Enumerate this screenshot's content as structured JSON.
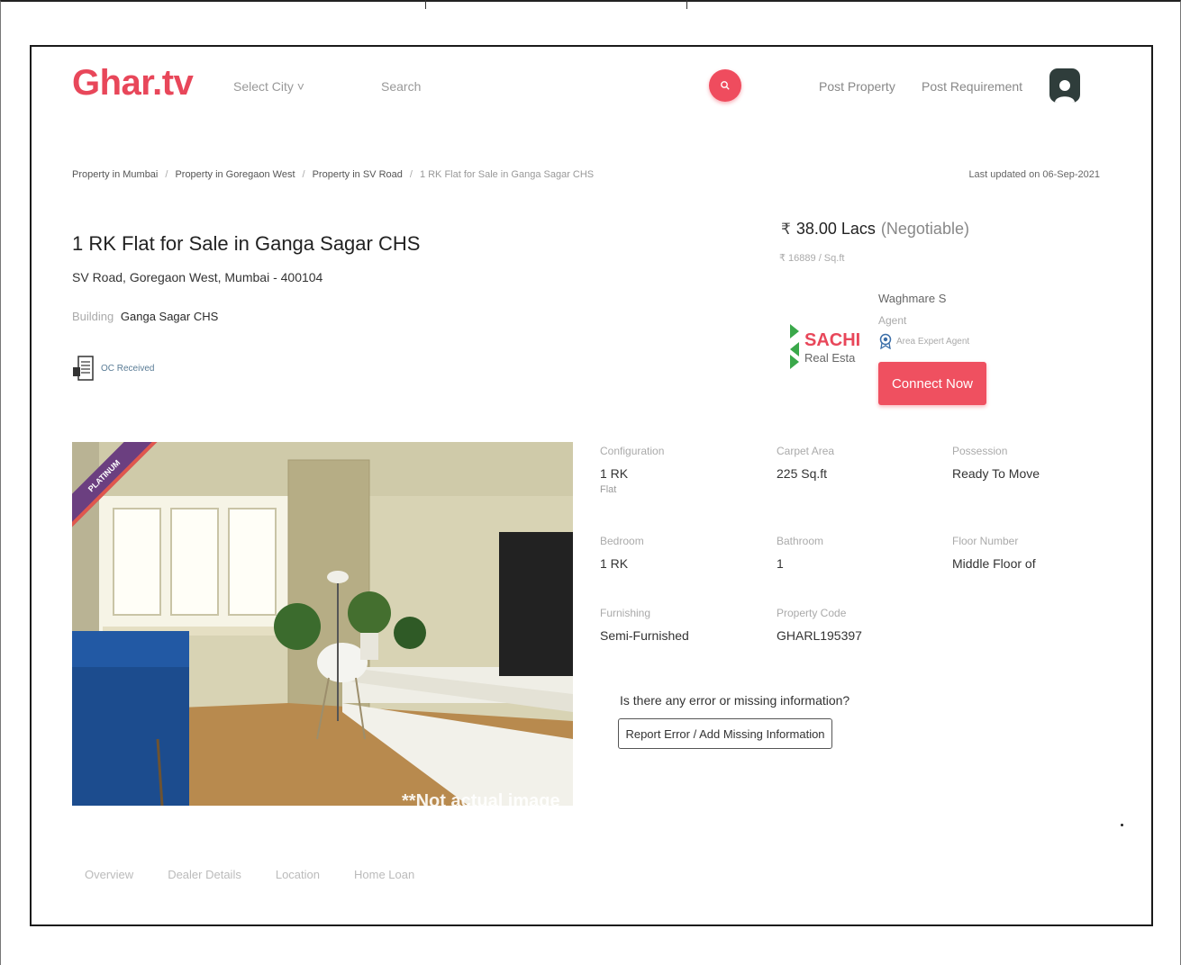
{
  "header": {
    "logo": "Ghar.tv",
    "city_select": "Select City ˅",
    "search_placeholder": "Search",
    "post_property": "Post Property",
    "post_requirement": "Post Requirement"
  },
  "breadcrumb": {
    "items": [
      "Property in Mumbai",
      "Property in Goregaon West",
      "Property in SV Road",
      "1 RK Flat for Sale in Ganga Sagar CHS"
    ],
    "separator": "/"
  },
  "last_updated": "Last updated on 06-Sep-2021",
  "listing": {
    "title": "1 RK Flat for Sale in Ganga Sagar CHS",
    "address": "SV Road, Goregaon West, Mumbai - 400104",
    "building_label": "Building",
    "building_value": "Ganga Sagar CHS",
    "oc_label": "OC Received",
    "price_symbol": "₹",
    "price": "38.00 Lacs",
    "negotiable": "(Negotiable)",
    "price_per_sqft": "₹ 16889 / Sq.ft",
    "photo_badge": "PLATINUM",
    "photo_caption": "**Not actual image"
  },
  "agent": {
    "logo_main": "SACHI",
    "logo_sub": "Real Esta",
    "name": "Waghmare S",
    "role": "Agent",
    "badge": "Area Expert Agent",
    "connect_button": "Connect Now"
  },
  "specs": [
    {
      "label": "Configuration",
      "value": "1 RK",
      "sub": "Flat"
    },
    {
      "label": "Carpet Area",
      "value": "225 Sq.ft",
      "sub": ""
    },
    {
      "label": "Possession",
      "value": "Ready To Move",
      "sub": ""
    },
    {
      "label": "Bedroom",
      "value": "1 RK",
      "sub": ""
    },
    {
      "label": "Bathroom",
      "value": "1",
      "sub": ""
    },
    {
      "label": "Floor Number",
      "value": "Middle Floor of",
      "sub": ""
    },
    {
      "label": "Furnishing",
      "value": "Semi-Furnished",
      "sub": ""
    },
    {
      "label": "Property Code",
      "value": "GHARL195397",
      "sub": ""
    }
  ],
  "error_report": {
    "question": "Is there any error or missing information?",
    "button": "Report Error / Add Missing Information"
  },
  "tabs": [
    "Overview",
    "Dealer Details",
    "Location",
    "Home Loan"
  ],
  "colors": {
    "brand": "#e8475a",
    "button": "#ef5060",
    "avatar": "#2f3d3b",
    "badge": "#6b3f80",
    "agent_logo_green": "#3aa84a"
  }
}
